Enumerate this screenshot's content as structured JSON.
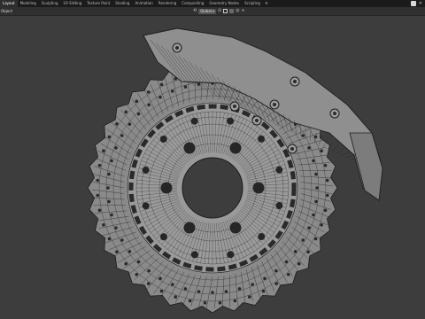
{
  "workspace_tabs": [
    {
      "label": "Layout",
      "active": true
    },
    {
      "label": "Modeling",
      "active": false
    },
    {
      "label": "Sculpting",
      "active": false
    },
    {
      "label": "UV Editing",
      "active": false
    },
    {
      "label": "Texture Paint",
      "active": false
    },
    {
      "label": "Shading",
      "active": false
    },
    {
      "label": "Animation",
      "active": false
    },
    {
      "label": "Rendering",
      "active": false
    },
    {
      "label": "Compositing",
      "active": false
    },
    {
      "label": "Geometry Nodes",
      "active": false
    },
    {
      "label": "Scripting",
      "active": false
    }
  ],
  "add_workspace": "+",
  "header": {
    "mode_label": "Object",
    "transform_orientation": "Global"
  },
  "colors": {
    "background": "#3d3d3d",
    "mesh_fill": "#8a8a8a",
    "wire": "#1c1c1c"
  },
  "icons": [
    "orientation-icon",
    "pivot-icon",
    "snap-icon",
    "proportional-icon",
    "scene-icon",
    "close-icon"
  ]
}
